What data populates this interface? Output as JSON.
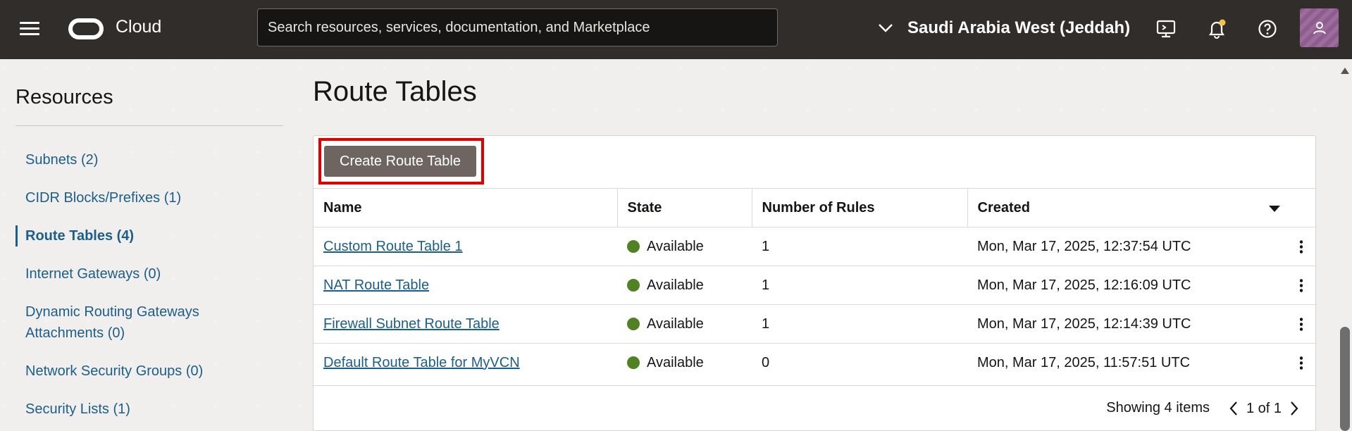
{
  "topbar": {
    "brand": "Cloud",
    "search_placeholder": "Search resources, services, documentation, and Marketplace",
    "region": "Saudi Arabia West (Jeddah)",
    "background": "#312d2a"
  },
  "sidebar": {
    "title": "Resources",
    "items": [
      {
        "label": "Subnets (2)"
      },
      {
        "label": "CIDR Blocks/Prefixes (1)"
      },
      {
        "label": "Route Tables (4)",
        "active": true
      },
      {
        "label": "Internet Gateways (0)"
      },
      {
        "label": "Dynamic Routing Gateways Attachments (0)"
      },
      {
        "label": "Network Security Groups (0)"
      },
      {
        "label": "Security Lists (1)"
      }
    ]
  },
  "main": {
    "title": "Route Tables",
    "create_button": "Create Route Table",
    "columns": [
      "Name",
      "State",
      "Number of Rules",
      "Created"
    ],
    "rows": [
      {
        "name": "Custom Route Table 1",
        "state": "Available",
        "rules": "1",
        "created": "Mon, Mar 17, 2025, 12:37:54 UTC"
      },
      {
        "name": "NAT Route Table",
        "state": "Available",
        "rules": "1",
        "created": "Mon, Mar 17, 2025, 12:16:09 UTC"
      },
      {
        "name": "Firewall Subnet Route Table",
        "state": "Available",
        "rules": "1",
        "created": "Mon, Mar 17, 2025, 12:14:39 UTC"
      },
      {
        "name": "Default Route Table for MyVCN",
        "state": "Available",
        "rules": "0",
        "created": "Mon, Mar 17, 2025, 11:57:51 UTC"
      }
    ],
    "showing": "Showing 4 items",
    "page": "1 of 1"
  },
  "colors": {
    "link": "#1c5e8a",
    "available": "#508223",
    "highlight": "#e00000",
    "button": "#6f6560"
  }
}
